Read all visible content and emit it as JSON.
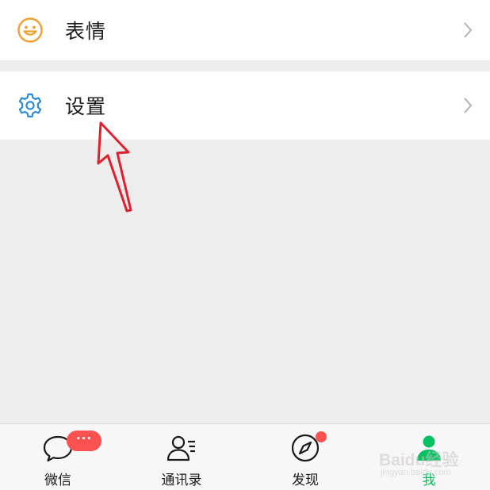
{
  "menu": {
    "items": [
      {
        "label": "表情",
        "icon": "smiley-icon"
      },
      {
        "label": "设置",
        "icon": "gear-icon"
      }
    ]
  },
  "annotation": {
    "icon": "red-arrow-icon",
    "color": "#e0202e"
  },
  "tabbar": {
    "tabs": [
      {
        "label": "微信",
        "icon": "chat-bubble-icon",
        "badge": "···"
      },
      {
        "label": "通讯录",
        "icon": "contacts-icon"
      },
      {
        "label": "发现",
        "icon": "compass-icon"
      },
      {
        "label": "我",
        "icon": "person-icon",
        "active": true
      }
    ]
  },
  "watermark": {
    "main": "Baidu经验",
    "sub": "jingyan.baidu.com"
  },
  "colors": {
    "accent_green": "#07c160",
    "badge_red": "#fa5151",
    "smiley_orange": "#f0a030",
    "gear_blue": "#2f8bd6",
    "background": "#ededed"
  }
}
